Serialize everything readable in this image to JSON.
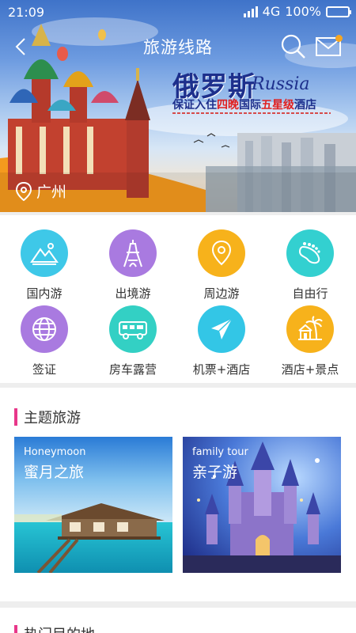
{
  "status": {
    "time": "21:09",
    "network": "4G",
    "battery": "100%",
    "battery_level": 1.0
  },
  "header": {
    "title": "旅游线路"
  },
  "promo": {
    "title": "俄罗斯",
    "title_en": "Russia",
    "sub_prefix": "保证入住",
    "sub_highlight": "四晚",
    "sub_middle": "国际",
    "sub_highlight2": "五星级",
    "sub_suffix": "酒店"
  },
  "location": {
    "city": "广州"
  },
  "categories": [
    {
      "label": "国内游",
      "icon": "mountain-icon",
      "color": "#3ec8e8"
    },
    {
      "label": "出境游",
      "icon": "eiffel-tower-icon",
      "color": "#a97ae0"
    },
    {
      "label": "周边游",
      "icon": "location-pin-icon",
      "color": "#f7b21b"
    },
    {
      "label": "自由行",
      "icon": "footprint-icon",
      "color": "#33d0d0"
    },
    {
      "label": "签证",
      "icon": "globe-icon",
      "color": "#a97ae0"
    },
    {
      "label": "房车露营",
      "icon": "rv-icon",
      "color": "#33d0c4"
    },
    {
      "label": "机票+酒店",
      "icon": "airplane-icon",
      "color": "#33c6e6"
    },
    {
      "label": "酒店+景点",
      "icon": "palm-house-icon",
      "color": "#f7b21b"
    }
  ],
  "theme": {
    "title": "主题旅游",
    "items": [
      {
        "en": "Honeymoon",
        "cn": "蜜月之旅"
      },
      {
        "en": "family tour",
        "cn": "亲子游"
      }
    ]
  },
  "hot": {
    "title": "热门目的地"
  }
}
